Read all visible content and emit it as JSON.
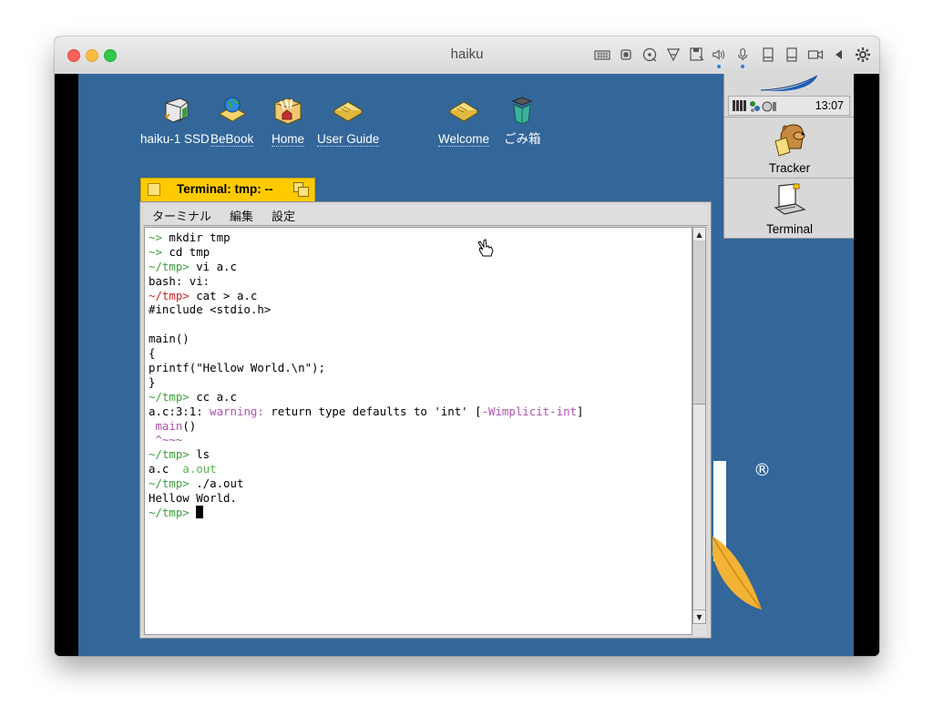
{
  "window": {
    "title": "haiku"
  },
  "desktop": {
    "icons": [
      {
        "id": "ssd",
        "label": "haiku-1 SSD"
      },
      {
        "id": "bebook",
        "label": "BeBook"
      },
      {
        "id": "home",
        "label": "Home"
      },
      {
        "id": "userguide",
        "label": "User Guide"
      },
      {
        "id": "welcome",
        "label": "Welcome"
      },
      {
        "id": "trash",
        "label": "ごみ箱"
      }
    ],
    "registered_mark": "®"
  },
  "terminal": {
    "tab_title": "Terminal: tmp: --",
    "menu": [
      "ターミナル",
      "編集",
      "設定"
    ],
    "lines": [
      [
        {
          "t": "~> ",
          "c": "green"
        },
        {
          "t": "mkdir tmp"
        }
      ],
      [
        {
          "t": "~> ",
          "c": "green"
        },
        {
          "t": "cd tmp"
        }
      ],
      [
        {
          "t": "~/tmp> ",
          "c": "green"
        },
        {
          "t": "vi a.c"
        }
      ],
      [
        {
          "t": "bash: vi:"
        }
      ],
      [
        {
          "t": "~/tmp> ",
          "c": "red"
        },
        {
          "t": "cat > a.c"
        }
      ],
      [
        {
          "t": "#include <stdio.h>"
        }
      ],
      [
        {
          "t": ""
        }
      ],
      [
        {
          "t": "main()"
        }
      ],
      [
        {
          "t": "{"
        }
      ],
      [
        {
          "t": "printf(\"Hellow World.\\n\");"
        }
      ],
      [
        {
          "t": "}"
        }
      ],
      [
        {
          "t": "~/tmp> ",
          "c": "green"
        },
        {
          "t": "cc a.c"
        }
      ],
      [
        {
          "t": "a.c:3:1: "
        },
        {
          "t": "warning:",
          "c": "purple"
        },
        {
          "t": " return type defaults to 'int' ["
        },
        {
          "t": "-Wimplicit-int",
          "c": "purple"
        },
        {
          "t": "]"
        }
      ],
      [
        {
          "t": " main",
          "c": "purple"
        },
        {
          "t": "()"
        }
      ],
      [
        {
          "t": " ^~~~",
          "c": "purple"
        }
      ],
      [
        {
          "t": "~/tmp> ",
          "c": "green"
        },
        {
          "t": "ls"
        }
      ],
      [
        {
          "t": "a.c  "
        },
        {
          "t": "a.out",
          "c": "lgreen"
        }
      ],
      [
        {
          "t": "~/tmp> ",
          "c": "green"
        },
        {
          "t": "./a.out"
        }
      ],
      [
        {
          "t": "Hellow World."
        }
      ],
      [
        {
          "t": "~/tmp> ",
          "c": "green"
        },
        {
          "t": "",
          "cursor": true
        }
      ]
    ]
  },
  "deskbar": {
    "clock": "13:07",
    "apps": [
      {
        "id": "tracker",
        "label": "Tracker"
      },
      {
        "id": "terminal",
        "label": "Terminal"
      }
    ]
  }
}
